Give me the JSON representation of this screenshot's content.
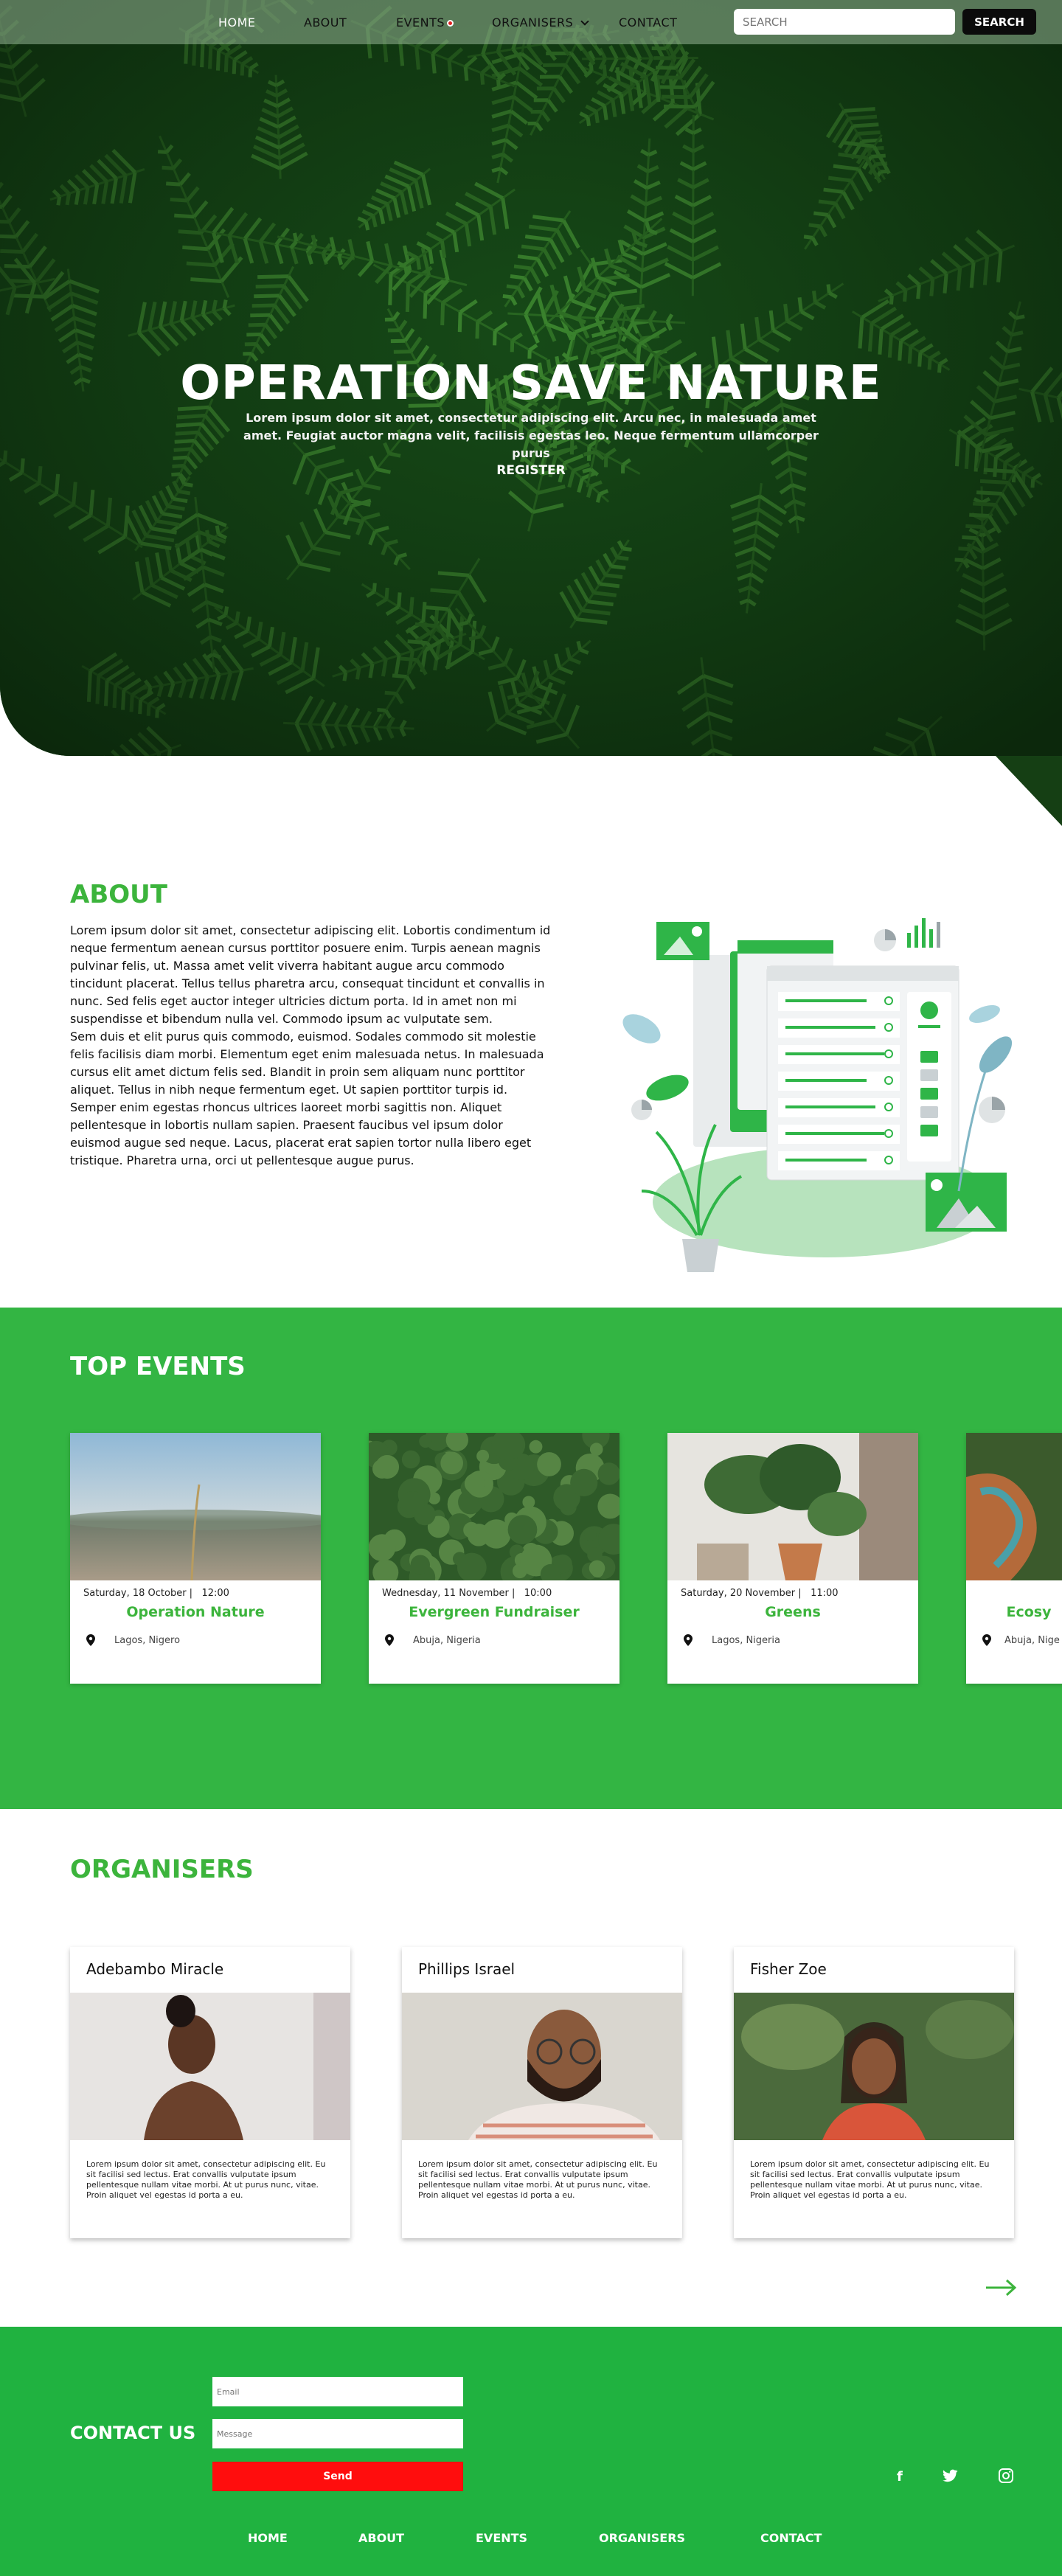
{
  "nav": {
    "items": [
      {
        "label": "HOME"
      },
      {
        "label": "ABOUT"
      },
      {
        "label": "EVENTS"
      },
      {
        "label": "ORGANISERS"
      },
      {
        "label": "CONTACT"
      }
    ],
    "search_placeholder": "SEARCH",
    "search_button": "SEARCH"
  },
  "hero": {
    "title": "OPERATION SAVE NATURE",
    "subtitle": "Lorem ipsum dolor sit amet, consectetur adipiscing elit. Arcu nec, in malesuada amet amet. Feugiat auctor magna velit, facilisis egestas leo. Neque fermentum ullamcorper purus",
    "cta": "REGISTER"
  },
  "about": {
    "title": "ABOUT",
    "paragraph1": "Lorem ipsum dolor sit amet, consectetur adipiscing elit. Lobortis condimentum id neque fermentum aenean cursus porttitor posuere enim. Turpis aenean magnis pulvinar felis, ut. Massa amet velit viverra habitant augue arcu commodo tincidunt placerat. Tellus tellus pharetra arcu, consequat tincidunt et convallis in nunc. Sed felis eget auctor integer ultricies dictum porta. Id in amet non mi suspendisse et bibendum nulla vel. Commodo ipsum ac vulputate sem.",
    "paragraph2": "Sem duis et elit purus quis commodo, euismod. Sodales commodo sit molestie felis facilisis diam morbi. Elementum eget enim malesuada netus. In malesuada cursus elit amet dictum felis sed. Blandit in proin sem aliquam nunc porttitor aliquet. Tellus in nibh neque fermentum eget. Ut sapien porttitor turpis id. Semper enim egestas rhoncus ultrices laoreet morbi sagittis non. Aliquet pellentesque in lobortis nullam sapien. Praesent faucibus vel ipsum dolor euismod augue sed neque. Lacus, placerat erat sapien tortor nulla libero eget tristique. Pharetra urna, orci ut pellentesque augue purus."
  },
  "events": {
    "title": "TOP EVENTS",
    "cards": [
      {
        "date": "Saturday, 18 October |",
        "time": "12:00",
        "name": "Operation Nature",
        "location": "Lagos, Nigero"
      },
      {
        "date": "Wednesday, 11 November |",
        "time": "10:00",
        "name": "Evergreen Fundraiser",
        "location": "Abuja, Nigeria"
      },
      {
        "date": "Saturday, 20 November |",
        "time": "11:00",
        "name": "Greens",
        "location": "Lagos, Nigeria"
      },
      {
        "date": "",
        "time": "",
        "name": "Ecosy",
        "location": "Abuja, Nige"
      }
    ]
  },
  "organisers": {
    "title": "ORGANISERS",
    "cards": [
      {
        "name": "Adebambo Miracle",
        "bio": "Lorem ipsum dolor sit amet, consectetur adipiscing elit. Eu sit facilisi sed lectus. Erat convallis vulputate ipsum pellentesque nullam vitae morbi. At ut purus nunc, vitae. Proin aliquet vel egestas id porta a eu."
      },
      {
        "name": "Phillips Israel",
        "bio": "Lorem ipsum dolor sit amet, consectetur adipiscing elit. Eu sit facilisi sed lectus. Erat convallis vulputate ipsum pellentesque nullam vitae morbi. At ut purus nunc, vitae. Proin aliquet vel egestas id porta a eu."
      },
      {
        "name": "Fisher Zoe",
        "bio": "Lorem ipsum dolor sit amet, consectetur adipiscing elit. Eu sit facilisi sed lectus. Erat convallis vulputate ipsum pellentesque nullam vitae morbi. At ut purus nunc, vitae. Proin aliquet vel egestas id porta a eu."
      }
    ],
    "next_icon": "arrow-right-icon"
  },
  "footer": {
    "contact_title": "CONTACT US",
    "email_placeholder": "Email",
    "message_placeholder": "Message",
    "send_label": "Send",
    "social_icons": [
      "facebook-icon",
      "twitter-icon",
      "instagram-icon"
    ],
    "social_glyphs": [
      "f",
      "t",
      "◎"
    ],
    "nav": [
      {
        "label": "HOME"
      },
      {
        "label": "ABOUT"
      },
      {
        "label": "EVENTS"
      },
      {
        "label": "ORGANISERS"
      },
      {
        "label": "CONTACT"
      }
    ]
  },
  "colors": {
    "brand_green": "#3cb43c",
    "events_bg": "#33b543",
    "footer_bg": "#20b240",
    "send_red": "#ff0d0d"
  }
}
